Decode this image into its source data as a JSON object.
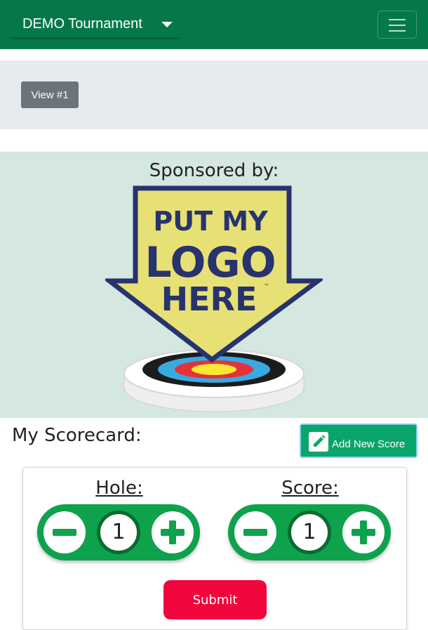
{
  "navbar": {
    "tournament": "DEMO Tournament"
  },
  "view_panel": {
    "button_label": "View #1"
  },
  "sponsor": {
    "heading": "Sponsored by:",
    "logo_text": [
      "PUT MY",
      "LOGO",
      "HERE"
    ],
    "logo_trademark": "™"
  },
  "scorecard": {
    "title": "My Scorecard:",
    "add_button_label": "Add New Score",
    "hole_label": "Hole:",
    "hole_value": "1",
    "score_label": "Score:",
    "score_value": "1",
    "submit_label": "Submit"
  },
  "colors": {
    "navbar": "#05784a",
    "stepper": "#0ea24c",
    "add_button": "#0aa56a",
    "submit": "#f0063d",
    "sponsor_bg": "#d4e7e1"
  },
  "icons": {
    "dropdown": "caret-down-icon",
    "menu": "hamburger-icon",
    "add": "pencil-square-icon",
    "decrement": "minus-icon",
    "increment": "plus-icon"
  }
}
